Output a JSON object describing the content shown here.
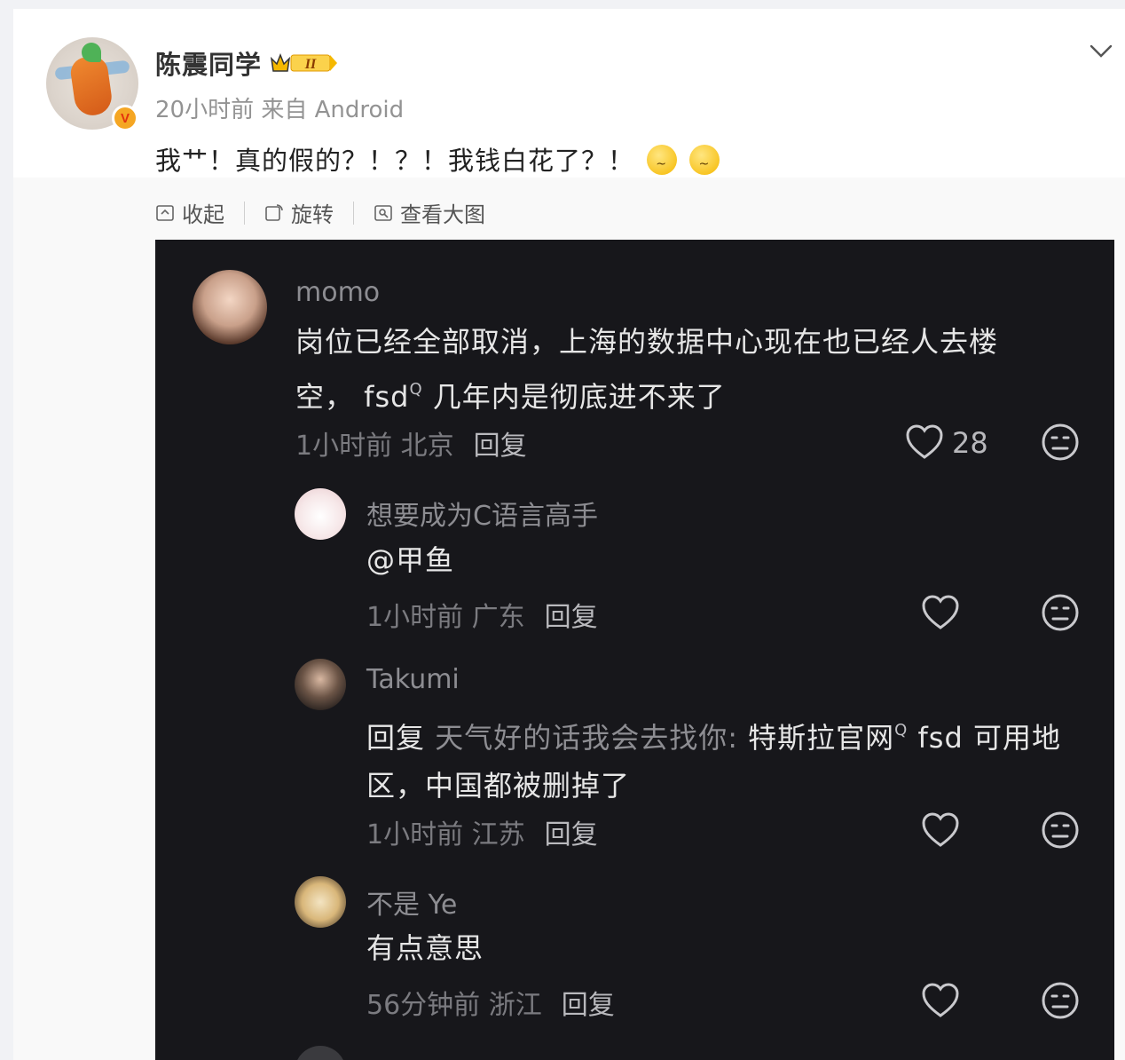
{
  "post": {
    "username": "陈震同学",
    "level_badge": "II",
    "verified_mark": "V",
    "time": "20小时前",
    "source": "来自 Android",
    "text": "我艹！真的假的？！？！我钱白花了？！",
    "emojis": [
      "dizzy-face-emoji",
      "dizzy-face-emoji"
    ]
  },
  "toolbar": {
    "collapse_label": "收起",
    "rotate_label": "旋转",
    "view_large_label": "查看大图"
  },
  "screenshot_comments": [
    {
      "name": "momo",
      "line1": "岗位已经全部取消，上海的数据中心现在也已经人去楼",
      "line2_prefix": "空，  fsd",
      "line2_suffix": " 几年内是彻底进不来了",
      "time_location": "1小时前 北京",
      "reply_label": "回复",
      "likes": "28"
    },
    {
      "name": "想要成为C语言高手",
      "line1": "@甲鱼",
      "time_location": "1小时前 广东",
      "reply_label": "回复"
    },
    {
      "name": "Takumi",
      "line1_prefix": "回复 ",
      "line1_target": "天气好的话我会去找你:",
      "line1_rest": " 特斯拉官网",
      "line1_tail": "  fsd 可用地",
      "line2": "区，中国都被删掉了",
      "time_location": "1小时前 江苏",
      "reply_label": "回复"
    },
    {
      "name": "不是 Ye",
      "line1": "有点意思",
      "time_location": "56分钟前 浙江",
      "reply_label": "回复"
    }
  ],
  "colors": {
    "page_bg": "#f1f2f5",
    "card_bg": "#ffffff",
    "screenshot_bg": "#17171b",
    "badge_orange": "#f5a623"
  }
}
